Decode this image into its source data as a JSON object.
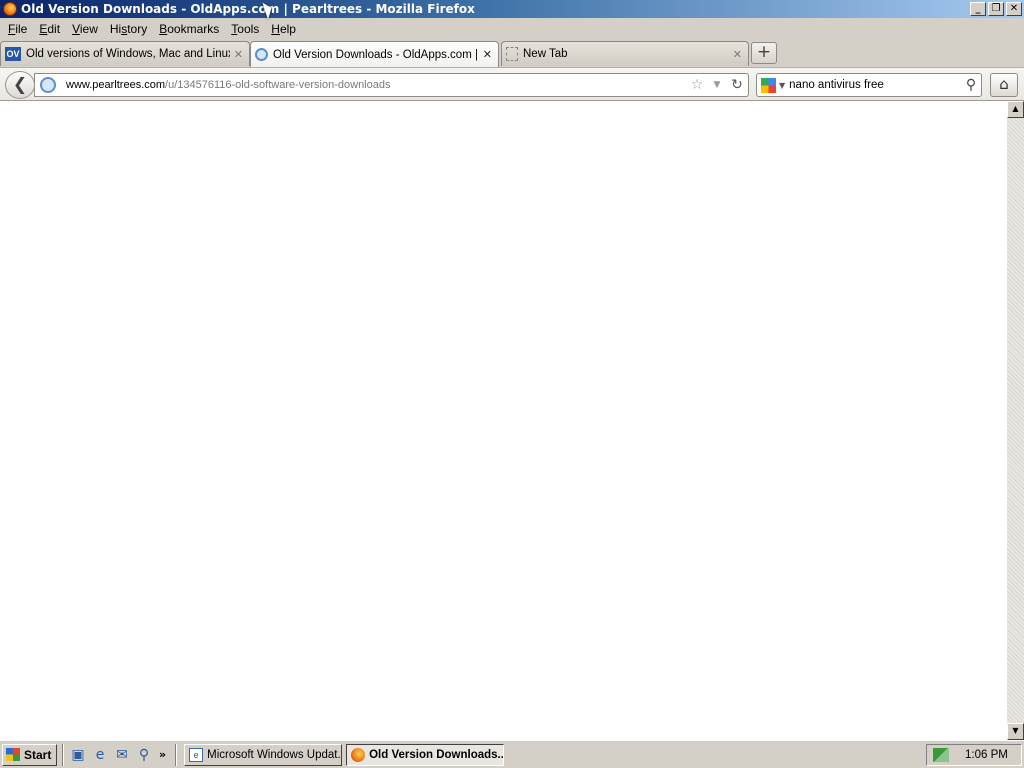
{
  "window": {
    "title": "Old Version Downloads - OldApps.com | Pearltrees - Mozilla Firefox",
    "minimize": "_",
    "restore": "❐",
    "close": "✕"
  },
  "menu": [
    {
      "pre": "",
      "ul": "F",
      "post": "ile"
    },
    {
      "pre": "",
      "ul": "E",
      "post": "dit"
    },
    {
      "pre": "",
      "ul": "V",
      "post": "iew"
    },
    {
      "pre": "Hi",
      "ul": "s",
      "post": "tory"
    },
    {
      "pre": "",
      "ul": "B",
      "post": "ookmarks"
    },
    {
      "pre": "",
      "ul": "T",
      "post": "ools"
    },
    {
      "pre": "",
      "ul": "H",
      "post": "elp"
    }
  ],
  "tabs": [
    {
      "favicon_text": "OV",
      "label": "Old versions of Windows, Mac and Linux ...",
      "close": "✕"
    },
    {
      "label": "Old Version Downloads - OldApps.com | P...",
      "close": "✕"
    },
    {
      "label": "New Tab",
      "close": "✕"
    }
  ],
  "new_tab_symbol": "+",
  "nav": {
    "back_symbol": "❮",
    "url_host": "www.pearltrees.com",
    "url_path": "/u/134576116-old-software-version-downloads",
    "bookmark_star": "☆",
    "dropdown": "▼",
    "reload": "↻",
    "search_value": "nano antivirus free",
    "search_dropdown": "▼",
    "search_icon": "⚲",
    "home_symbol": "⌂"
  },
  "scrollbar": {
    "up": "▲",
    "down": "▼"
  },
  "taskbar": {
    "start_label": "Start",
    "quicklaunch": [
      "▣",
      "e",
      "✉",
      "⚲"
    ],
    "chevron": "»",
    "buttons": [
      {
        "icon_text": "e",
        "label": "Microsoft Windows Updat..."
      },
      {
        "label": "Old Version Downloads..."
      }
    ],
    "clock": "1:06 PM"
  }
}
